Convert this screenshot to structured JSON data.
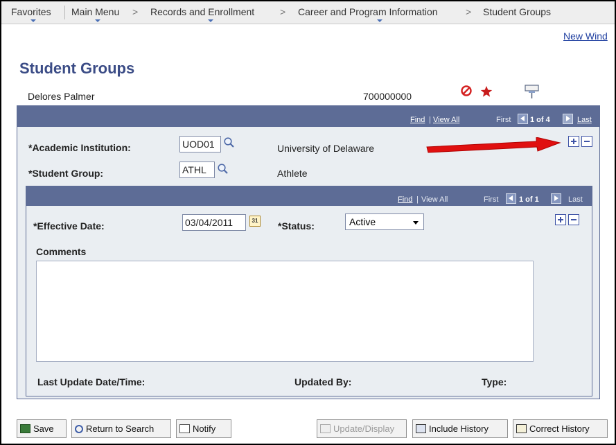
{
  "nav": {
    "favorites": "Favorites",
    "main_menu": "Main Menu",
    "sep": ">",
    "records": "Records and Enrollment",
    "career": "Career and Program Information",
    "student_groups": "Student Groups"
  },
  "new_window": "New Wind",
  "page_title": "Student Groups",
  "student": {
    "name": "Delores Palmer",
    "id": "700000000"
  },
  "outer_nav": {
    "find": "Find",
    "sep": "|",
    "view_all": "View All",
    "first": "First",
    "count": "1 of 4",
    "last": "Last"
  },
  "institution": {
    "label": "*Academic Institution:",
    "value": "UOD01",
    "description": "University of Delaware"
  },
  "student_group": {
    "label": "*Student Group:",
    "value": "ATHL",
    "description": "Athlete"
  },
  "inner_nav": {
    "find": "Find",
    "sep": "|",
    "view_all": "View All",
    "first": "First",
    "count": "1 of 1",
    "last": "Last"
  },
  "effective_date": {
    "label": "*Effective Date:",
    "value": "03/04/2011",
    "calendar": "31"
  },
  "status": {
    "label": "*Status:",
    "value": "Active"
  },
  "comments": {
    "label": "Comments",
    "value": ""
  },
  "footer_labels": {
    "last_update": "Last Update Date/Time:",
    "updated_by": "Updated By:",
    "type": "Type:"
  },
  "toolbar": {
    "save": "Save",
    "return": "Return to Search",
    "notify": "Notify",
    "update": "Update/Display",
    "include_history": "Include History",
    "correct_history": "Correct History"
  },
  "icons": {
    "prohibited": "prohibited-icon",
    "star": "star-icon",
    "pin": "pin-icon",
    "lookup": "magnifier-icon",
    "calendar": "calendar-icon",
    "arrow": "red-arrow-annotation"
  },
  "colors": {
    "header_bar": "#5d6c96",
    "panel_bg": "#eaeef2",
    "title": "#3b4c86",
    "annotation_arrow": "#e01010"
  }
}
